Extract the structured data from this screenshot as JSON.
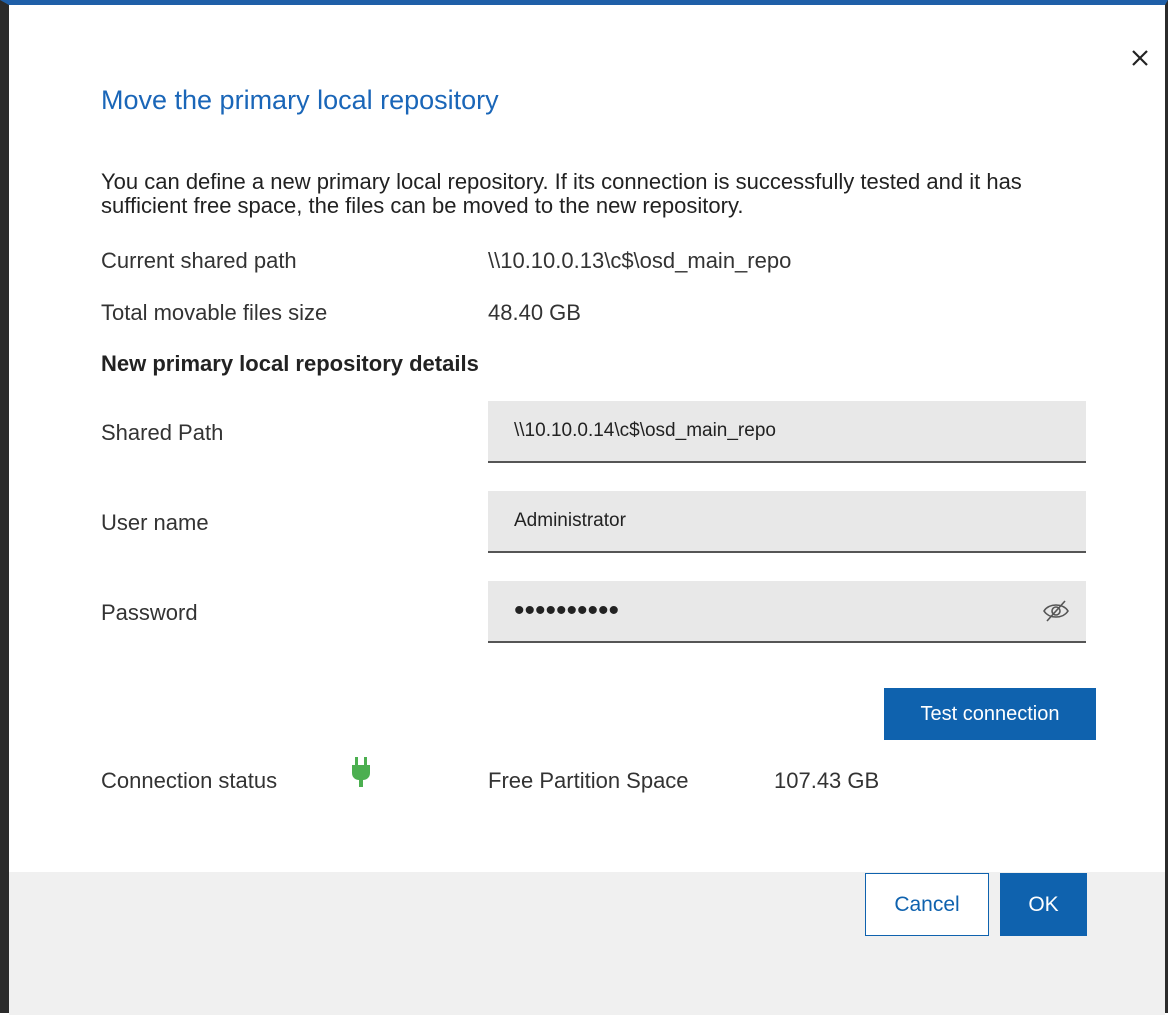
{
  "dialog": {
    "title": "Move the primary local repository",
    "intro": "You can define a new primary local repository. If its connection is successfully tested and it has sufficient free space, the files can be moved to the new repository.",
    "close_icon": "close-icon"
  },
  "current": {
    "shared_path_label": "Current shared path",
    "shared_path_value": "\\\\10.10.0.13\\c$\\osd_main_repo",
    "size_label": "Total movable files size",
    "size_value": "48.40 GB"
  },
  "new_repo": {
    "section_title": "New primary local repository details",
    "shared_path_label": "Shared Path",
    "shared_path_value": "\\\\10.10.0.14\\c$\\osd_main_repo",
    "username_label": "User name",
    "username_value": "Administrator",
    "password_label": "Password",
    "password_value": "••••••••••",
    "password_toggle_icon": "eye-hidden-icon"
  },
  "test": {
    "button_label": "Test connection",
    "status_label": "Connection status",
    "status_icon": "plug-connected-icon",
    "status_color": "#4caf50",
    "free_space_label": "Free Partition Space",
    "free_space_value": "107.43 GB"
  },
  "footer": {
    "cancel_label": "Cancel",
    "ok_label": "OK"
  },
  "colors": {
    "accent": "#0f62ae",
    "title": "#1a66b8",
    "field_bg": "#e8e8e8",
    "footer_bg": "#f0f0f0"
  }
}
